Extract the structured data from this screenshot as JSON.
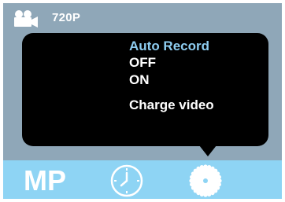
{
  "status": {
    "resolution": "720P",
    "camera_icon": "video-camera-icon"
  },
  "menu": {
    "title": "Auto Record",
    "items": [
      {
        "label": "OFF"
      },
      {
        "label": "ON"
      },
      {
        "label": "Charge video"
      }
    ]
  },
  "bottom_bar": {
    "mode_label": "MP",
    "clock_icon": "clock-icon",
    "settings_icon": "gear-icon"
  },
  "colors": {
    "screen_background": "#8fa7b8",
    "popup_background": "#000000",
    "title_text": "#8ecdf1",
    "item_text": "#ffffff",
    "bottom_bar": "#8ed4f4"
  }
}
